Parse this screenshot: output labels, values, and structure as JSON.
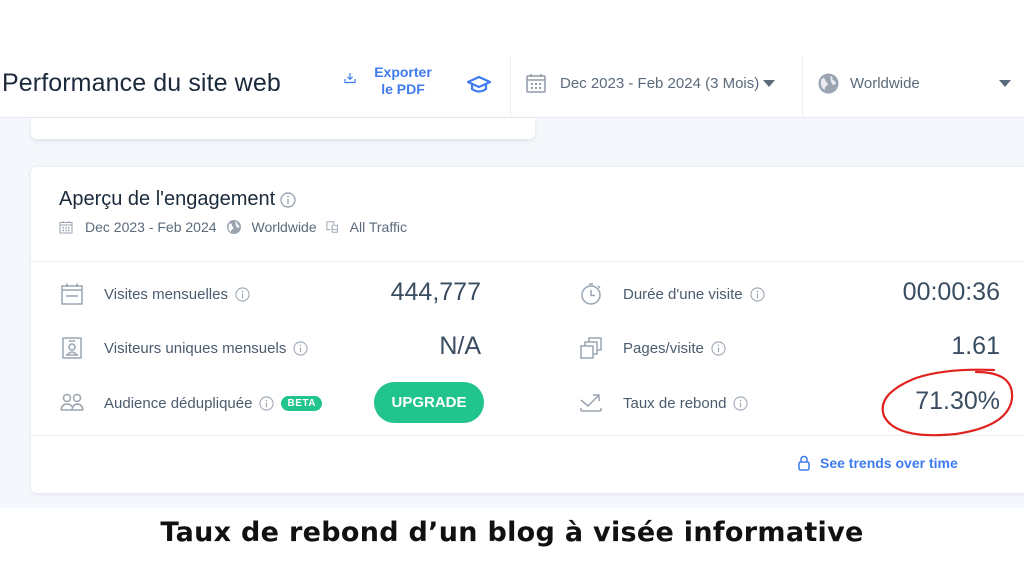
{
  "header": {
    "title": "Performance du site web",
    "export_label_line1": "Exporter",
    "export_label_line2": "le PDF",
    "date_range": "Dec 2023 - Feb 2024 (3 Mois)",
    "country": "Worldwide"
  },
  "engagement_card": {
    "title": "Aperçu de l'engagement",
    "sub_date": "Dec 2023 - Feb 2024",
    "sub_country": "Worldwide",
    "sub_traffic": "All Traffic",
    "metrics_left": [
      {
        "icon": "calendar-icon",
        "label": "Visites mensuelles",
        "value": "444,777"
      },
      {
        "icon": "id-card-icon",
        "label": "Visiteurs uniques mensuels",
        "value": "N/A"
      },
      {
        "icon": "users-icon",
        "label": "Audience dédupliquée",
        "badge": "BETA",
        "button": "UPGRADE"
      }
    ],
    "metrics_right": [
      {
        "icon": "stopwatch-icon",
        "label": "Durée d'une visite",
        "value": "00:00:36"
      },
      {
        "icon": "pages-icon",
        "label": "Pages/visite",
        "value": "1.61"
      },
      {
        "icon": "bounce-icon",
        "label": "Taux de rebond",
        "value": "71.30%"
      }
    ],
    "trends_link": "See trends over time"
  },
  "caption": "Taux de rebond d’un blog à visée informative",
  "colors": {
    "accent_blue": "#3f7bf0",
    "upgrade_green": "#21c48c",
    "highlight_red": "#e0231f"
  }
}
